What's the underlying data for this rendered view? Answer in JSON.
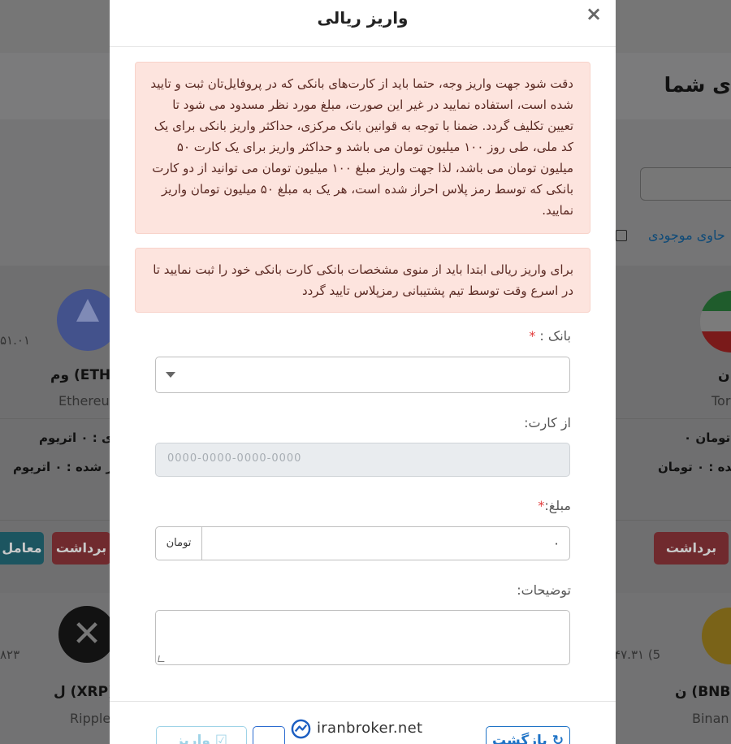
{
  "background": {
    "page_title": "ی شما",
    "filter_label": "حاوی موجودی",
    "cards": [
      {
        "symbol_name": "وم (ETH)",
        "latin": "Ethereu",
        "price": "۵۱.۰۱",
        "balance": "دی : ۰ اتریوم",
        "deposited": "ریز شده : ۰ اتریوم",
        "withdraw_label": "برداشت",
        "trade_label": "معامل"
      },
      {
        "symbol_name": "ن",
        "latin": "Tor",
        "balance": "۰ تومان",
        "deposited": "شده : ۰ تومان",
        "withdraw_label": "برداشت"
      },
      {
        "symbol_name": "ل (XRP)",
        "latin": "Ripple",
        "price": "۸۲۳"
      },
      {
        "symbol_name": "ن (BNB)",
        "latin": "Binan",
        "price": "۵۴۷.۳۱ (5"
      }
    ]
  },
  "modal": {
    "title": "واریز ریالی",
    "close_symbol": "×",
    "alert_1": "دقت شود جهت واریز وجه، حتما باید از کارت‌های بانکی که در پروفایل‌تان ثبت و تایید شده است، استفاده نمایید در غیر این صورت، مبلغ مورد نظر مسدود می شود تا تعیین تکلیف گردد. ضمنا با توجه به قوانین بانک مرکزی، حداکثر واریز بانکی برای یک کد ملی، طی روز ۱۰۰ میلیون تومان می باشد و حداکثر واریز برای یک کارت ۵۰ میلیون تومان می باشد، لذا جهت واریز مبلغ ۱۰۰ میلیون تومان می توانید از دو کارت بانکی که توسط رمز پلاس احراز شده است، هر یک به مبلغ ۵۰ میلیون تومان واریز نمایید.",
    "alert_2": "برای واریز ریالی ابتدا باید از منوی مشخصات بانکی کارت بانکی خود را ثبت نمایید تا در اسرع وقت توسط تیم پشتیبانی رمزپلاس تایید گردد",
    "bank_label": "بانک :",
    "required_mark": "*",
    "card_label": "از کارت:",
    "card_placeholder": "0000-0000-0000-0000",
    "amount_label": "مبلغ:",
    "amount_addon": "تومان",
    "amount_value": "۰",
    "description_label": "توضیحات:",
    "deposit_button": "واریز ☑",
    "back_button": "بازگشت ↻"
  },
  "watermark": {
    "text": "iranbroker.net"
  }
}
